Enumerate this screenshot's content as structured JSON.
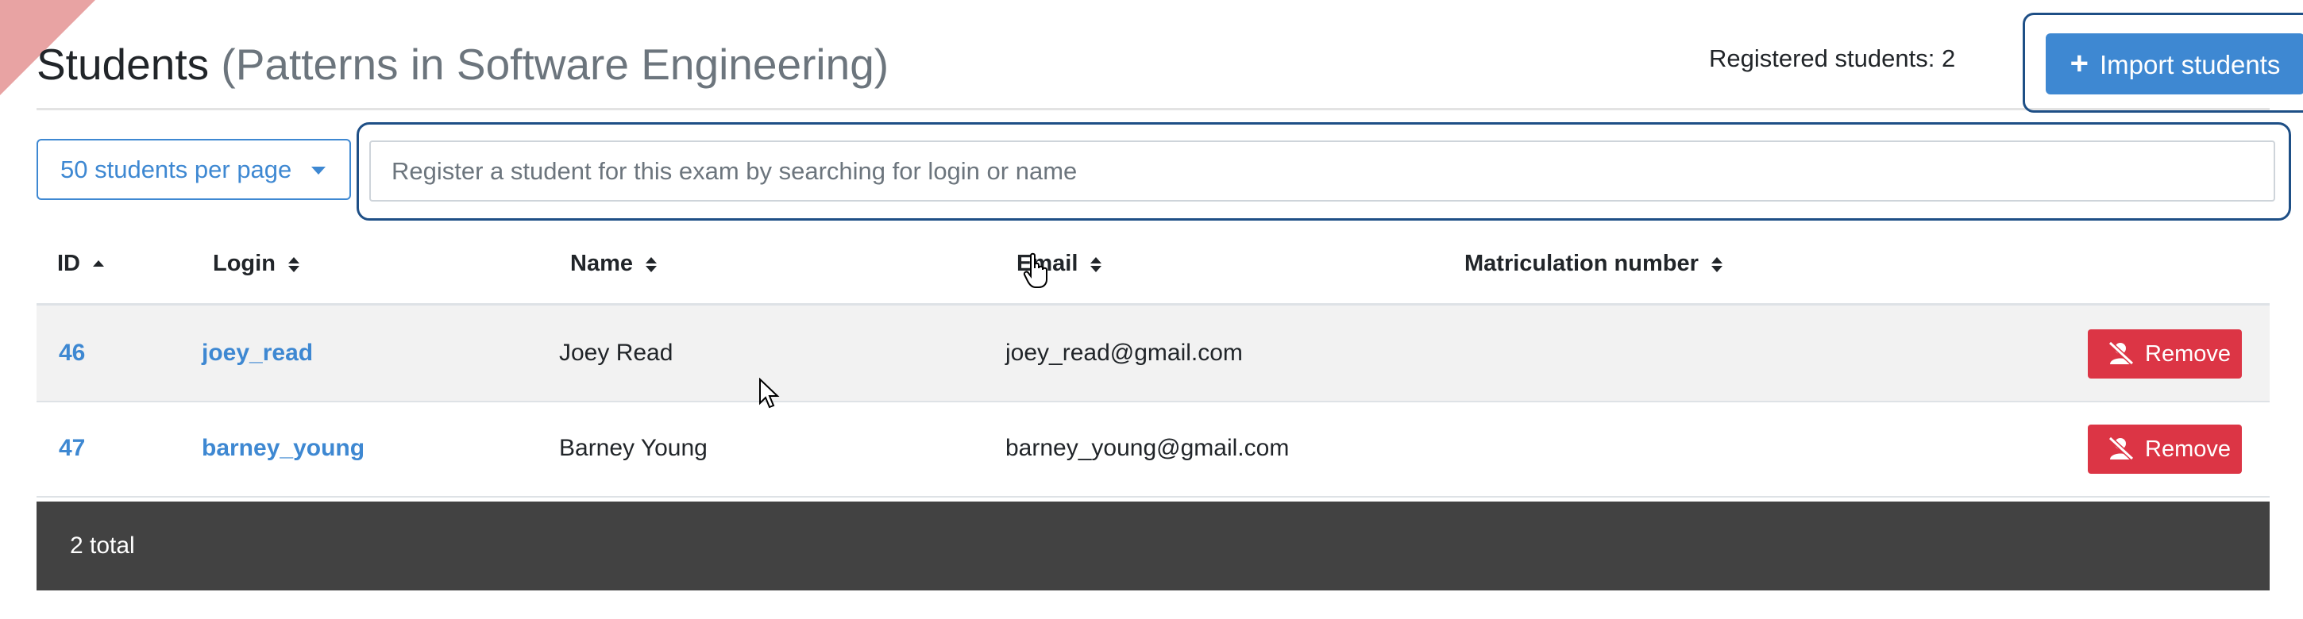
{
  "page": {
    "title": "Students",
    "subtitle": "(Patterns in Software Engineering)",
    "registered_text": "Registered students: 2",
    "import_button": "Import students"
  },
  "controls": {
    "per_page_label": "50 students per page",
    "search_placeholder": "Register a student for this exam by searching for login or name",
    "search_value": ""
  },
  "table": {
    "columns": [
      "ID",
      "Login",
      "Name",
      "Email",
      "Matriculation number"
    ],
    "rows": [
      {
        "id": "46",
        "login": "joey_read",
        "name": "Joey Read",
        "email": "joey_read@gmail.com",
        "matriculation": "",
        "action": "Remove"
      },
      {
        "id": "47",
        "login": "barney_young",
        "name": "Barney Young",
        "email": "barney_young@gmail.com",
        "matriculation": "",
        "action": "Remove"
      }
    ],
    "footer": "2 total"
  },
  "colors": {
    "primary": "#3e88d2",
    "danger": "#dc3545",
    "footer_bg": "#424242",
    "focus_outline": "#1e4f86"
  },
  "icons": [
    "plus-icon",
    "caret-down-icon",
    "sort-icon",
    "user-remove-icon",
    "hand-cursor-icon",
    "arrow-cursor-icon"
  ]
}
